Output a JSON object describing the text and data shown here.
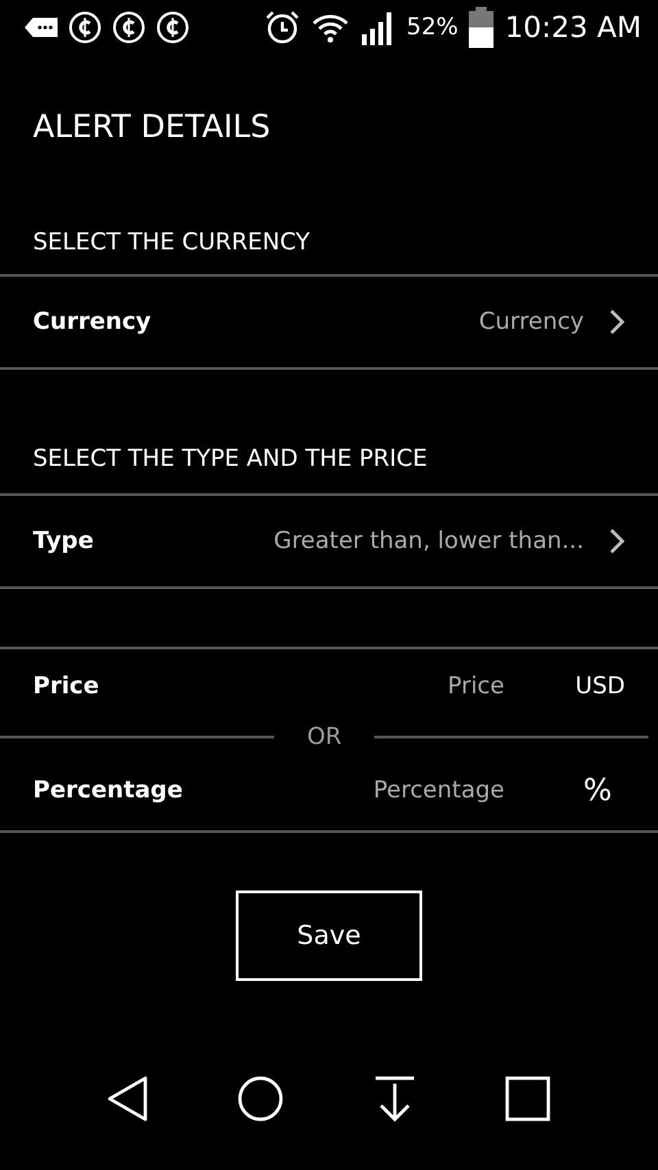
{
  "status_bar": {
    "battery": "52%",
    "time": "10:23 AM"
  },
  "title": "ALERT DETAILS",
  "currency_section": {
    "header": "SELECT THE CURRENCY",
    "row": {
      "label": "Currency",
      "value": "Currency"
    }
  },
  "type_section": {
    "header": "SELECT THE TYPE AND THE PRICE",
    "row": {
      "label": "Type",
      "value": "Greater than, lower than..."
    }
  },
  "price": {
    "label": "Price",
    "placeholder": "Price",
    "unit": "USD"
  },
  "separator": "OR",
  "percentage": {
    "label": "Percentage",
    "placeholder": "Percentage",
    "unit": "%"
  },
  "save_button": "Save"
}
